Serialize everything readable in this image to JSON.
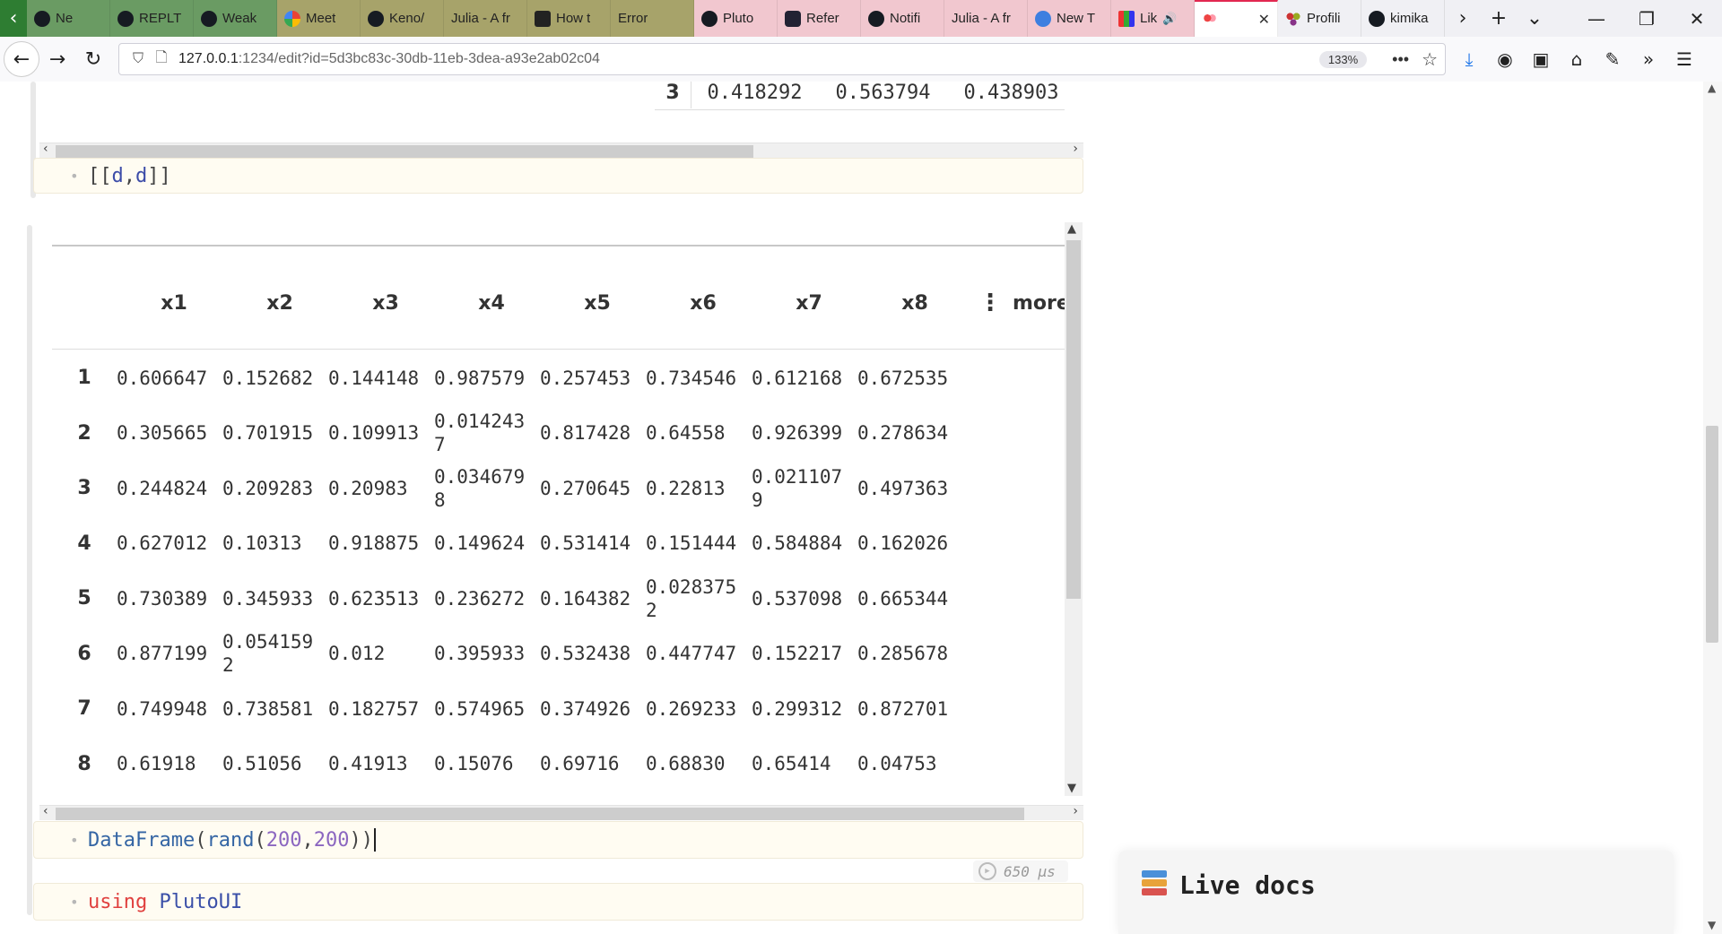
{
  "tabs": [
    {
      "label": "Ne",
      "favicon": "github-icon",
      "style": "green"
    },
    {
      "label": "REPLT",
      "favicon": "github-icon",
      "style": "green"
    },
    {
      "label": "Weak",
      "favicon": "github-icon",
      "style": "green"
    },
    {
      "label": "Meet",
      "favicon": "google-meet-icon",
      "style": "olive"
    },
    {
      "label": "Keno/",
      "favicon": "github-icon",
      "style": "olive"
    },
    {
      "label": "Julia - A fr",
      "favicon": "",
      "style": "olive"
    },
    {
      "label": "How t",
      "favicon": "hex-icon",
      "style": "olive"
    },
    {
      "label": "Error",
      "favicon": "",
      "style": "olive"
    },
    {
      "label": "Pluto",
      "favicon": "github-icon",
      "style": "pink"
    },
    {
      "label": "Refer",
      "favicon": "reference-icon",
      "style": "pink"
    },
    {
      "label": "Notifi",
      "favicon": "github-icon",
      "style": "pink"
    },
    {
      "label": "Julia - A fr",
      "favicon": "",
      "style": "pink"
    },
    {
      "label": "New T",
      "favicon": "firefox-icon",
      "style": "pink"
    },
    {
      "label": "Lik",
      "favicon": "chart-icon",
      "style": "pink"
    },
    {
      "label": "",
      "favicon": "pluto-icon",
      "style": "active"
    },
    {
      "label": "Profili",
      "favicon": "profiling-icon",
      "style": "plain"
    },
    {
      "label": "kimika",
      "favicon": "github-icon",
      "style": "plain"
    }
  ],
  "browser": {
    "url_host": "127.0.0.1",
    "url_rest": ":1234/edit?id=5d3bc83c-30db-11eb-3dea-a93e2ab02c04",
    "zoom": "133%"
  },
  "prev_table_last_row": {
    "index": "3",
    "values": [
      "0.418292",
      "0.563794",
      "0.438903"
    ]
  },
  "cell_dd": {
    "code": [
      "[[",
      "d",
      ",",
      "d",
      "]]"
    ]
  },
  "dataframe": {
    "columns": [
      "x1",
      "x2",
      "x3",
      "x4",
      "x5",
      "x6",
      "x7",
      "x8"
    ],
    "more_label": "more",
    "rows": [
      {
        "index": "1",
        "values": [
          "0.606647",
          "0.152682",
          "0.144148",
          "0.987579",
          "0.257453",
          "0.734546",
          "0.612168",
          "0.672535"
        ]
      },
      {
        "index": "2",
        "values": [
          "0.305665",
          "0.701915",
          "0.109913",
          "0.0142437",
          "0.817428",
          "0.64558",
          "0.926399",
          "0.278634"
        ]
      },
      {
        "index": "3",
        "values": [
          "0.244824",
          "0.209283",
          "0.20983",
          "0.0346798",
          "0.270645",
          "0.22813",
          "0.0211079",
          "0.497363"
        ]
      },
      {
        "index": "4",
        "values": [
          "0.627012",
          "0.10313",
          "0.918875",
          "0.149624",
          "0.531414",
          "0.151444",
          "0.584884",
          "0.162026"
        ]
      },
      {
        "index": "5",
        "values": [
          "0.730389",
          "0.345933",
          "0.623513",
          "0.236272",
          "0.164382",
          "0.0283752",
          "0.537098",
          "0.665344"
        ]
      },
      {
        "index": "6",
        "values": [
          "0.877199",
          "0.0541592",
          "0.012",
          "0.395933",
          "0.532438",
          "0.447747",
          "0.152217",
          "0.285678"
        ]
      },
      {
        "index": "7",
        "values": [
          "0.749948",
          "0.738581",
          "0.182757",
          "0.574965",
          "0.374926",
          "0.269233",
          "0.299312",
          "0.872701"
        ]
      },
      {
        "index": "8",
        "values": [
          "0.61918",
          "0.51056",
          "0.41913",
          "0.15076",
          "0.69716",
          "0.68830",
          "0.65414",
          "0.04753"
        ]
      }
    ]
  },
  "cell_dataframe": {
    "fn1": "DataFrame",
    "fn2": "rand",
    "arg1": "200",
    "arg2": "200"
  },
  "runtime": "650 μs",
  "cell_using": {
    "keyword": "using",
    "module": "PlutoUI"
  },
  "live_docs": {
    "title": "Live docs"
  }
}
